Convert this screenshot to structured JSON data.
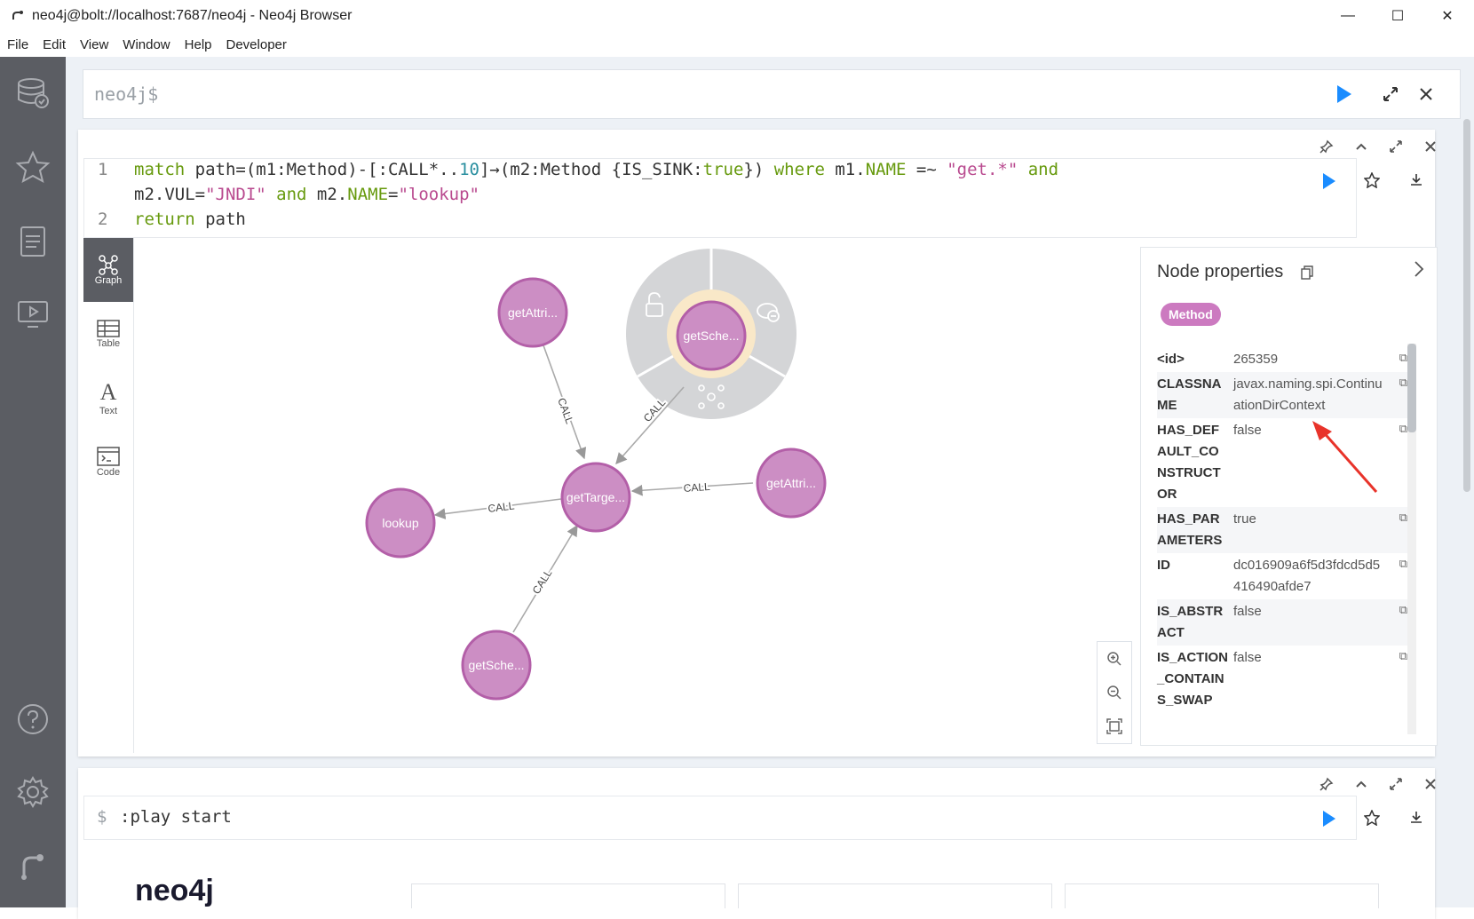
{
  "window": {
    "title": "neo4j@bolt://localhost:7687/neo4j - Neo4j Browser",
    "minimize": "—",
    "maximize": "☐",
    "close": "✕"
  },
  "menu": [
    "File",
    "Edit",
    "View",
    "Window",
    "Help",
    "Developer"
  ],
  "editor": {
    "prompt": "neo4j$"
  },
  "frame1": {
    "line1_num": "1",
    "line2_num": "2",
    "tokens_line1a": {
      "match": "match",
      "path": " path=(m1:Method)-[:CALL*..",
      "ten": "10",
      "rest": "]→(m2:Method {IS_SINK:",
      "true": "true",
      "close": "}) ",
      "where": "where",
      "m1": " m1.",
      "name": "NAME",
      "op": " =~ ",
      "getstr": "\"get.*\"",
      "and": " and"
    },
    "tokens_line1b": {
      "m2": "m2.VUL=",
      "jndi": "\"JNDI\"",
      "and": " and",
      "m2name": " m2.",
      "name": "NAME",
      "eq": "=",
      "lookup": "\"lookup\""
    },
    "tokens_line2": {
      "return": "return",
      "path": " path"
    }
  },
  "view_tabs": [
    {
      "label": "Graph",
      "active": true
    },
    {
      "label": "Table",
      "active": false
    },
    {
      "label": "Text",
      "active": false
    },
    {
      "label": "Code",
      "active": false
    }
  ],
  "graph": {
    "rel_label": "CALL",
    "nodes": {
      "getAttri1": "getAttri...",
      "getSche1": "getSche...",
      "getTarge": "getTarge...",
      "getAttri2": "getAttri...",
      "lookup": "lookup",
      "getSche2": "getSche..."
    }
  },
  "props": {
    "title": "Node properties",
    "label_badge": "Method",
    "rows": [
      {
        "key": "<id>",
        "value": "265359"
      },
      {
        "key": "CLASSNAME",
        "value": "javax.naming.spi.ContinuationDirContext"
      },
      {
        "key": "HAS_DEFAULT_CONSTRUCTOR",
        "value": "false"
      },
      {
        "key": "HAS_PARAMETERS",
        "value": "true"
      },
      {
        "key": "ID",
        "value": "dc016909a6f5d3fdcd5d5416490afde7"
      },
      {
        "key": "IS_ABSTRACT",
        "value": "false"
      },
      {
        "key": "IS_ACTION_CONTAINS_SWAP",
        "value": "false"
      }
    ]
  },
  "frame2": {
    "prompt": "$",
    "command": ":play start"
  },
  "bottom": {
    "logo": "neo4j"
  },
  "colors": {
    "node_fill": "#cc8ec4",
    "node_stroke": "#b35fa8",
    "accent": "#1a8cff",
    "badge": "#cc7ac0"
  }
}
